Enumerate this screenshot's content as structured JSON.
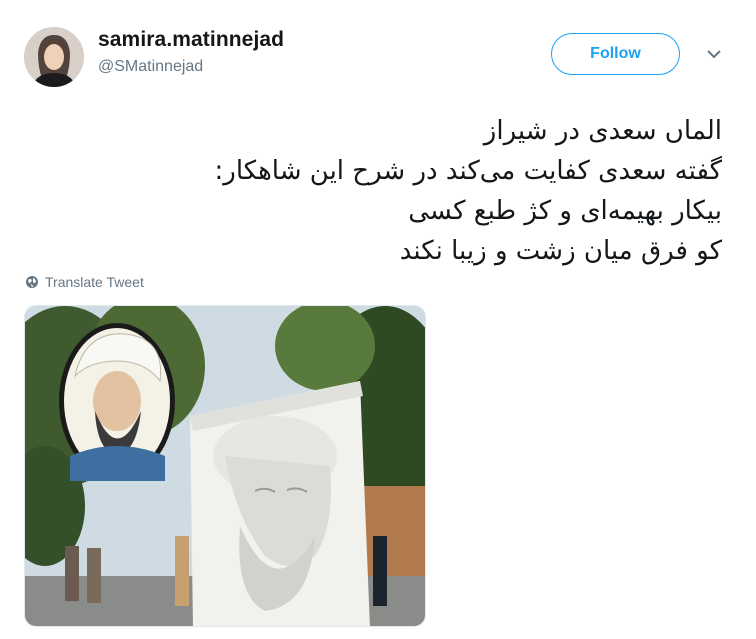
{
  "user": {
    "display_name": "samira.matinnejad",
    "handle": "@SMatinnejad"
  },
  "follow_label": "Follow",
  "tweet_lines": [
    "الماں سعدی در شیراز",
    "گفته سعدی کفایت می‌کند در شرح این شاهکار:",
    "بیکار بهیمه‌ای و کژ طبع کسی",
    "کو فرق میان زشت و زیبا نکند"
  ],
  "translate_label": "Translate Tweet",
  "icons": {
    "caret": "chevron-down-icon",
    "translate": "globe-icon"
  },
  "colors": {
    "accent": "#1da1f2",
    "secondary_text": "#657786",
    "primary_text": "#14171a"
  }
}
